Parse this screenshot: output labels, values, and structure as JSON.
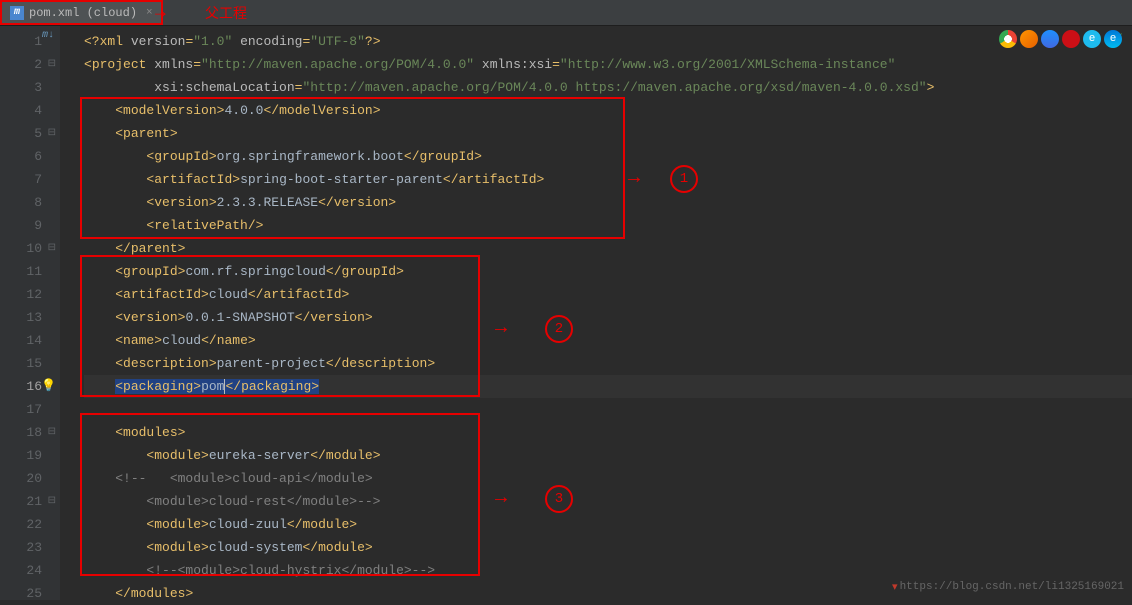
{
  "tab": {
    "icon_letter": "m",
    "label": "pom.xml (cloud)",
    "annotation_arrow": "→",
    "annotation_text": "父工程"
  },
  "gutter_lines": [
    "1",
    "2",
    "3",
    "4",
    "5",
    "6",
    "7",
    "8",
    "9",
    "10",
    "11",
    "12",
    "13",
    "14",
    "15",
    "16",
    "17",
    "18",
    "19",
    "20",
    "21",
    "22",
    "23",
    "24",
    "25"
  ],
  "current_line": 16,
  "code": {
    "line1": {
      "prefix": "<?",
      "tag": "xml",
      "attr1": " version",
      "val1": "\"1.0\"",
      "attr2": " encoding",
      "val2": "\"UTF-8\"",
      "suffix": "?>"
    },
    "line2": {
      "open": "<",
      "tag": "project",
      "attr1": " xmlns",
      "val1": "\"http://maven.apache.org/POM/4.0.0\"",
      "attr2": " xmlns:xsi",
      "val2": "\"http://www.w3.org/2001/XMLSchema-instance\""
    },
    "line3": {
      "attr": "xsi:schemaLocation",
      "val": "\"http://maven.apache.org/POM/4.0.0 https://maven.apache.org/xsd/maven-4.0.0.xsd\"",
      "close": ">"
    },
    "line4": {
      "open": "<",
      "tag": "modelVersion",
      "close1": ">",
      "content": "4.0.0",
      "open2": "</",
      "close2": ">"
    },
    "line5": {
      "open": "<",
      "tag": "parent",
      "close": ">"
    },
    "line6": {
      "open": "<",
      "tag": "groupId",
      "close1": ">",
      "content": "org.springframework.boot",
      "open2": "</",
      "close2": ">"
    },
    "line7": {
      "open": "<",
      "tag": "artifactId",
      "close1": ">",
      "content": "spring-boot-starter-parent",
      "open2": "</",
      "close2": ">"
    },
    "line8": {
      "open": "<",
      "tag": "version",
      "close1": ">",
      "content": "2.3.3.RELEASE",
      "open2": "</",
      "close2": ">"
    },
    "line9": {
      "open": "<",
      "tag": "relativePath",
      "close": "/>"
    },
    "line10": {
      "open": "</",
      "tag": "parent",
      "close": ">"
    },
    "line11": {
      "open": "<",
      "tag": "groupId",
      "close1": ">",
      "content": "com.rf.springcloud",
      "open2": "</",
      "close2": ">"
    },
    "line12": {
      "open": "<",
      "tag": "artifactId",
      "close1": ">",
      "content": "cloud",
      "open2": "</",
      "close2": ">"
    },
    "line13": {
      "open": "<",
      "tag": "version",
      "close1": ">",
      "content": "0.0.1-SNAPSHOT",
      "open2": "</",
      "close2": ">"
    },
    "line14": {
      "open": "<",
      "tag": "name",
      "close1": ">",
      "content": "cloud",
      "open2": "</",
      "close2": ">"
    },
    "line15": {
      "open": "<",
      "tag": "description",
      "close1": ">",
      "content": "parent-project",
      "open2": "</",
      "close2": ">"
    },
    "line16": {
      "open": "<",
      "tag": "packaging",
      "close1": ">",
      "content": "pom",
      "open2": "</",
      "close2": ">"
    },
    "line18": {
      "open": "<",
      "tag": "modules",
      "close": ">"
    },
    "line19": {
      "open": "<",
      "tag": "module",
      "close1": ">",
      "content": "eureka-server",
      "open2": "</",
      "close2": ">"
    },
    "line20": {
      "comment_open": "<!--   <module>",
      "content": "cloud-api",
      "comment_close": "</module>"
    },
    "line21": {
      "comment_open": "<module>",
      "content": "cloud-rest",
      "comment_close": "</module>-->"
    },
    "line22": {
      "open": "<",
      "tag": "module",
      "close1": ">",
      "content": "cloud-zuul",
      "open2": "</",
      "close2": ">"
    },
    "line23": {
      "open": "<",
      "tag": "module",
      "close1": ">",
      "content": "cloud-system",
      "open2": "</",
      "close2": ">"
    },
    "line24": {
      "comment_open": "<!--<module>",
      "content": "cloud-hystrix",
      "comment_close": "</module>-->"
    },
    "line25": {
      "open": "</",
      "tag": "modules",
      "close": ">"
    }
  },
  "annotations": {
    "label1": "1",
    "label2": "2",
    "label3": "3",
    "arrow": "→"
  },
  "watermark": "https://blog.csdn.net/li1325169021",
  "ml_icon": "m↓",
  "check": "✓"
}
